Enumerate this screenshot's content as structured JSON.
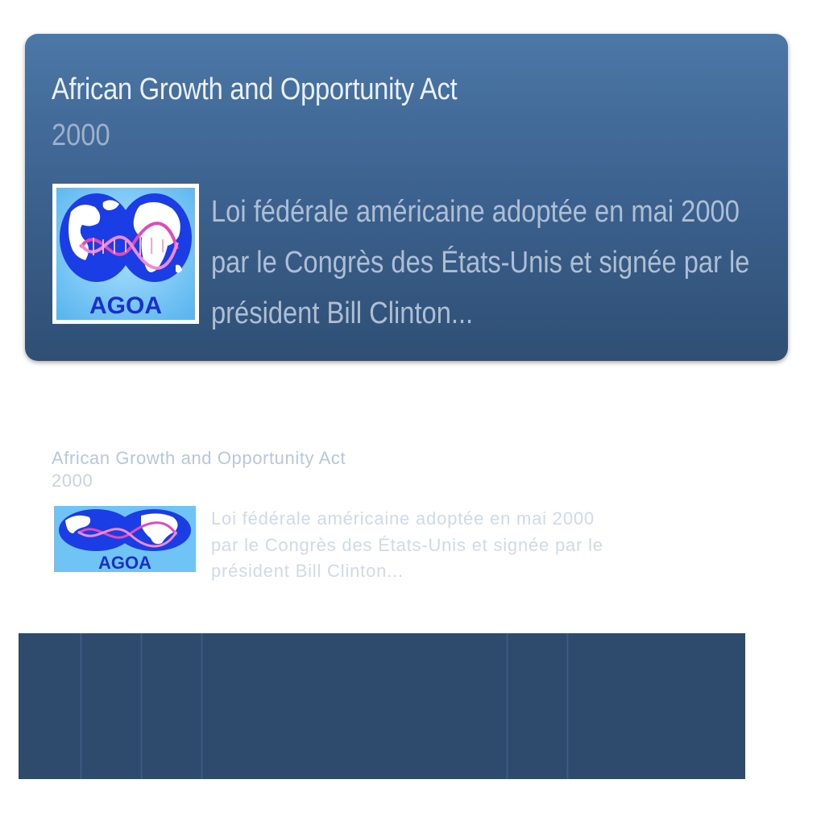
{
  "card": {
    "title": "African Growth and Opportunity Act",
    "year": "2000",
    "logo_text": "AGOA",
    "description_lines": [
      "Loi fédérale américaine adoptée en mai 2000",
      "par le Congrès des États-Unis et signée par le",
      "président Bill Clinton..."
    ]
  },
  "ghost": {
    "title": "African Growth and Opportunity Act",
    "year": "2000",
    "logo_text": "AGOA",
    "description_lines": [
      "Loi fédérale américaine adoptée en mai 2000",
      "par le Congrès des États-Unis et signée par le",
      "président Bill Clinton..."
    ]
  },
  "colors": {
    "card_top": "#4c77a6",
    "card_bottom": "#2f4f74",
    "bar": "#2e4b6d",
    "logo_blue": "#1a3fe0",
    "logo_bg": "#6fc3f5",
    "logo_helix": "#e24ab5"
  }
}
